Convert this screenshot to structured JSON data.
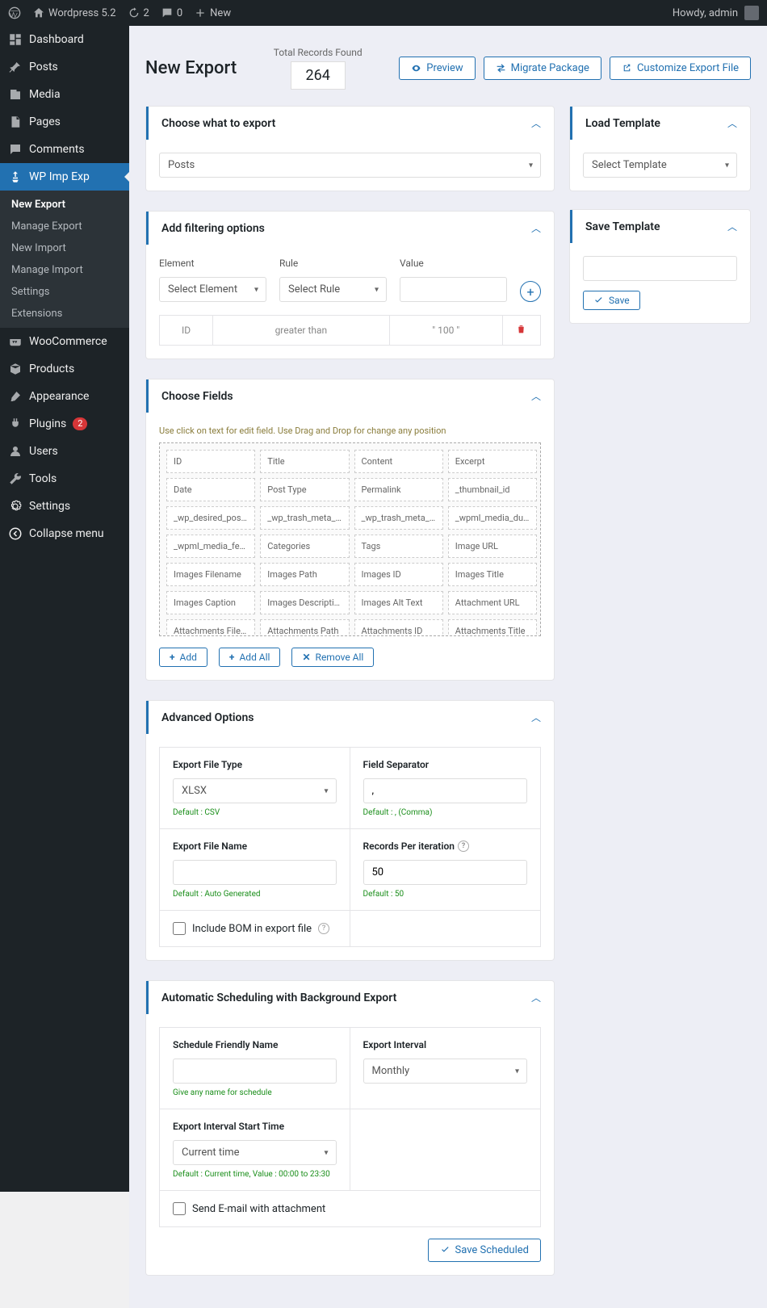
{
  "topBar": {
    "site": "Wordpress 5.2",
    "updates": "2",
    "comments": "0",
    "new": "New",
    "greeting": "Howdy, admin"
  },
  "sidebar": {
    "items": [
      {
        "label": "Dashboard",
        "icon": "dashboard"
      },
      {
        "label": "Posts",
        "icon": "pin"
      },
      {
        "label": "Media",
        "icon": "media"
      },
      {
        "label": "Pages",
        "icon": "page"
      },
      {
        "label": "Comments",
        "icon": "comment"
      },
      {
        "label": "WP Imp Exp",
        "icon": "impexp",
        "active": true
      },
      {
        "label": "WooCommerce",
        "icon": "woo"
      },
      {
        "label": "Products",
        "icon": "product"
      },
      {
        "label": "Appearance",
        "icon": "brush"
      },
      {
        "label": "Plugins",
        "icon": "plug",
        "badge": "2"
      },
      {
        "label": "Users",
        "icon": "user"
      },
      {
        "label": "Tools",
        "icon": "tool"
      },
      {
        "label": "Settings",
        "icon": "settings"
      },
      {
        "label": "Collapse menu",
        "icon": "collapse"
      }
    ],
    "submenu": [
      {
        "label": "New Export",
        "current": true
      },
      {
        "label": "Manage Export"
      },
      {
        "label": "New Import"
      },
      {
        "label": "Manage Import"
      },
      {
        "label": "Settings"
      },
      {
        "label": "Extensions"
      }
    ]
  },
  "header": {
    "title": "New Export",
    "totalLabel": "Total Records Found",
    "totalCount": "264",
    "btnPreview": "Preview",
    "btnMigrate": "Migrate Package",
    "btnCustomize": "Customize Export File"
  },
  "panel": {
    "chooseWhat": {
      "title": "Choose what to export",
      "value": "Posts"
    },
    "addFilter": {
      "title": "Add filtering options",
      "labels": {
        "element": "Element",
        "rule": "Rule",
        "value": "Value"
      },
      "placeholders": {
        "element": "Select Element",
        "rule": "Select Rule"
      },
      "row": {
        "element": "ID",
        "rule": "greater than",
        "value": "\" 100 \""
      }
    },
    "fields": {
      "title": "Choose Fields",
      "hint": "Use click on text for edit field. Use Drag and Drop for change any position",
      "chips": [
        "ID",
        "Title",
        "Content",
        "Excerpt",
        "Date",
        "Post Type",
        "Permalink",
        "_thumbnail_id",
        "_wp_desired_post_slug",
        "_wp_trash_meta_status",
        "_wp_trash_meta_time",
        "_wpml_media_duplicate",
        "_wpml_media_featured",
        "Categories",
        "Tags",
        "Image URL",
        "Images Filename",
        "Images Path",
        "Images ID",
        "Images Title",
        "Images Caption",
        "Images Description",
        "Images Alt Text",
        "Attachment URL",
        "Attachments Filename",
        "Attachments Path",
        "Attachments ID",
        "Attachments Title"
      ],
      "btnAdd": "Add",
      "btnAddAll": "Add All",
      "btnRemoveAll": "Remove All"
    },
    "advanced": {
      "title": "Advanced Options",
      "fileTypeLabel": "Export File Type",
      "fileType": "XLSX",
      "fileTypeHint": "Default : CSV",
      "sepLabel": "Field Separator",
      "sepValue": ",",
      "sepHint": "Default : , (Comma)",
      "nameLabel": "Export File Name",
      "nameHint": "Default : Auto Generated",
      "recordsLabel": "Records Per iteration",
      "recordsValue": "50",
      "recordsHint": "Default : 50",
      "bomLabel": "Include BOM in export file"
    },
    "schedule": {
      "title": "Automatic Scheduling with Background Export",
      "friendlyLabel": "Schedule Friendly Name",
      "friendlyHint": "Give any name for schedule",
      "intervalLabel": "Export Interval",
      "interval": "Monthly",
      "startLabel": "Export Interval Start Time",
      "start": "Current time",
      "startHint": "Default : Current time, Value : 00:00 to 23:30",
      "emailLabel": "Send E-mail with attachment",
      "btnSave": "Save Scheduled"
    },
    "loadTemplate": {
      "title": "Load Template",
      "placeholder": "Select Template"
    },
    "saveTemplate": {
      "title": "Save Template",
      "btnSave": "Save"
    }
  }
}
